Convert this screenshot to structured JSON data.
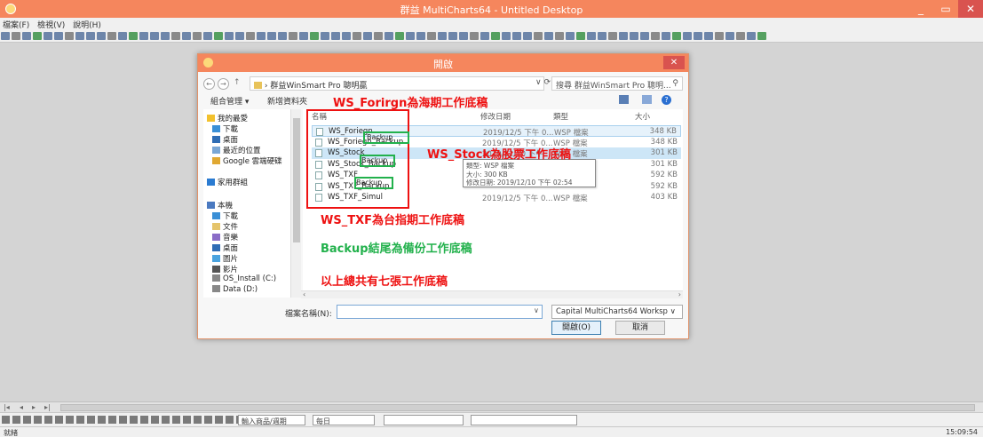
{
  "app": {
    "title": "群益 MultiCharts64 - Untitled Desktop",
    "menu": [
      "檔案(F)",
      "檢視(V)",
      "說明(H)"
    ],
    "min_glyph": "_",
    "max_glyph": "▭",
    "close_glyph": "✕"
  },
  "dialog": {
    "title": "開啟",
    "close_glyph": "✕",
    "address_path": "群益WinSmart Pro 聰明贏",
    "address_arrow": "›",
    "search_placeholder": "搜尋 群益WinSmart Pro 聰明...",
    "search_icon": "search-icon",
    "organize_label": "組合管理 ▾",
    "new_folder_label": "新增資料夾",
    "columns": {
      "name": "名稱",
      "date": "修改日期",
      "type": "類型",
      "size": "大小"
    },
    "nav": [
      {
        "label": "我的最愛",
        "icon": "star-icon"
      },
      {
        "label": "下載",
        "icon": "download-folder-icon"
      },
      {
        "label": "桌面",
        "icon": "desktop-icon"
      },
      {
        "label": "最近的位置",
        "icon": "recent-places-icon"
      },
      {
        "label": "Google 雲端硬碟",
        "icon": "google-drive-icon"
      },
      {
        "label": "家用群組",
        "icon": "homegroup-icon"
      },
      {
        "label": "本機",
        "icon": "computer-icon"
      },
      {
        "label": "下載",
        "icon": "download-folder-icon"
      },
      {
        "label": "文件",
        "icon": "documents-icon"
      },
      {
        "label": "音樂",
        "icon": "music-icon"
      },
      {
        "label": "桌面",
        "icon": "desktop-icon"
      },
      {
        "label": "圖片",
        "icon": "pictures-icon"
      },
      {
        "label": "影片",
        "icon": "videos-icon"
      },
      {
        "label": "OS_Install (C:)",
        "icon": "drive-icon"
      },
      {
        "label": "Data (D:)",
        "icon": "drive-icon"
      }
    ],
    "files": [
      {
        "name": "WS_Foriegn",
        "date": "2019/12/5 下午 0...",
        "type": "WSP 檔案",
        "size": "348 KB"
      },
      {
        "name": "WS_Foriegn_Backup",
        "date": "2019/12/5 下午 0...",
        "type": "WSP 檔案",
        "size": "348 KB"
      },
      {
        "name": "WS_Stock",
        "date": "2019/12/10 下午 ...",
        "type": "WSP 檔案",
        "size": "301 KB"
      },
      {
        "name": "WS_Stock_Backup",
        "date": "",
        "type": "",
        "size": "301 KB"
      },
      {
        "name": "WS_TXF",
        "date": "",
        "type": "",
        "size": "592 KB"
      },
      {
        "name": "WS_TXF_Backup",
        "date": "",
        "type": "",
        "size": "592 KB"
      },
      {
        "name": "WS_TXF_Simul",
        "date": "2019/12/5 下午 0...",
        "type": "WSP 檔案",
        "size": "403 KB"
      }
    ],
    "tooltip": [
      "類型: WSP 檔案",
      "大小: 300 KB",
      "修改日期: 2019/12/10 下午 02:54"
    ],
    "filename_label": "檔案名稱(N):",
    "filename_value": "",
    "filetype_value": "Capital MultiCharts64 Worksp ∨",
    "open_label": "開啟(O)",
    "cancel_label": "取消"
  },
  "annotations": {
    "foreign": "WS_Forirgn為海期工作底稿",
    "stock": "WS_Stock為股票工作底稿",
    "txf": "WS_TXF為台指期工作底稿",
    "backup": "Backup結尾為備份工作底稿",
    "total": "以上總共有七張工作底稿",
    "backup_tag": "Backup"
  },
  "bottom": {
    "symbol_input": "輸入商品/週期",
    "combo_label": "每日",
    "status_left": "就緒",
    "clock": "15:09:54"
  },
  "colors": {
    "accent": "#f5865d",
    "annotation_red": "#e11111",
    "annotation_green": "#22b14c"
  }
}
